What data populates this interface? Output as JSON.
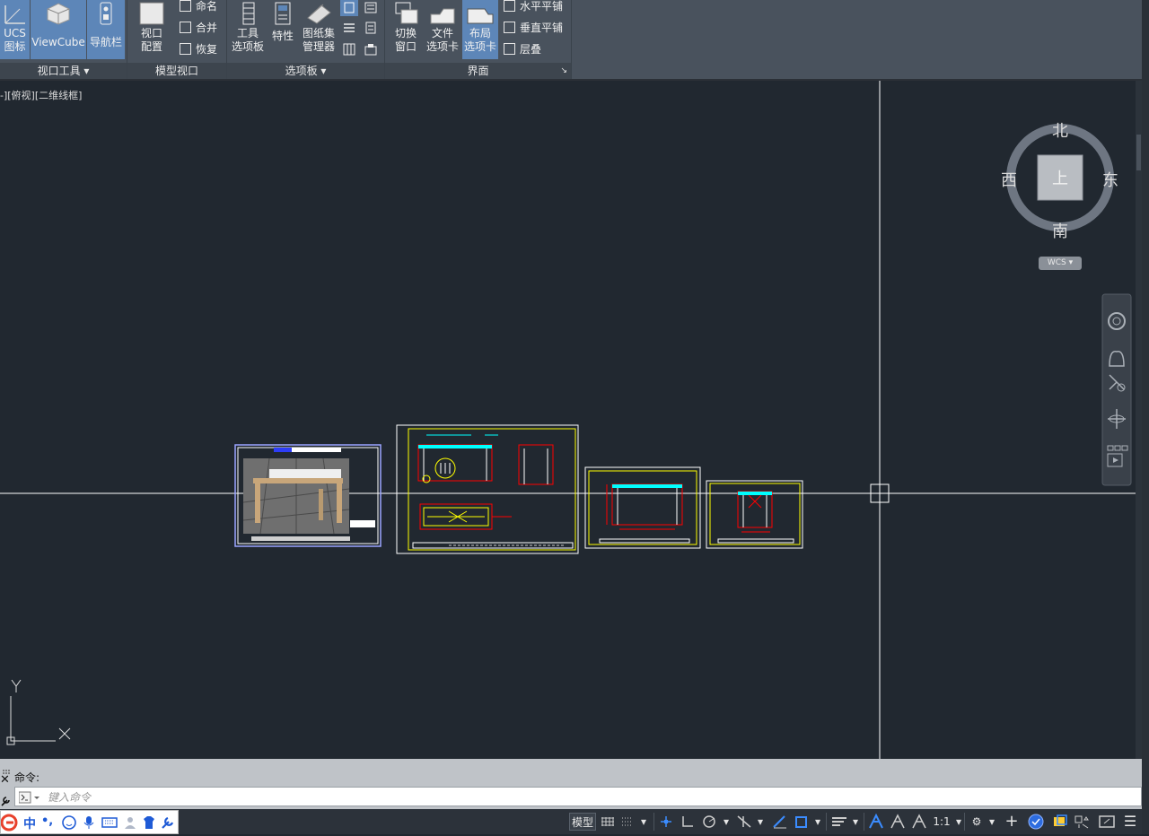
{
  "ribbon": {
    "panels": {
      "viewport_tools": {
        "title": "视口工具",
        "ucs_icon": "UCS\n图标",
        "viewcube": "ViewCube",
        "navbar": "导航栏"
      },
      "model_viewports": {
        "title": "模型视口",
        "viewport_config": "视口\n配置",
        "named": "命名",
        "join": "合并",
        "restore": "恢复"
      },
      "palettes": {
        "title": "选项板",
        "tool_palettes": "工具\n选项板",
        "properties": "特性",
        "sheet_set": "图纸集\n管理器"
      },
      "interface": {
        "title": "界面",
        "switch_windows": "切换\n窗口",
        "file_tabs": "文件\n选项卡",
        "layout_tabs": "布局\n选项卡",
        "tile_horizontal": "水平平铺",
        "tile_vertical": "垂直平铺",
        "cascade": "层叠"
      }
    }
  },
  "viewport": {
    "label": "-][俯视][二维线框]",
    "compass": {
      "north": "北",
      "south": "南",
      "east": "东",
      "west": "西",
      "top": "上"
    },
    "wcs": "WCS",
    "ucs_axes": {
      "x": "X",
      "y": "Y"
    }
  },
  "command": {
    "history": "命令:",
    "placeholder": "键入命令"
  },
  "status": {
    "model": "模型",
    "scale": "1:1"
  },
  "ime": {
    "lang": "中"
  },
  "colors": {
    "canvas": "#212830",
    "ribbon": "#49525d",
    "active_button": "#5d86b8",
    "cad_yellow": "#ffff00",
    "cad_red": "#ff0000",
    "cad_cyan": "#00ffff"
  }
}
